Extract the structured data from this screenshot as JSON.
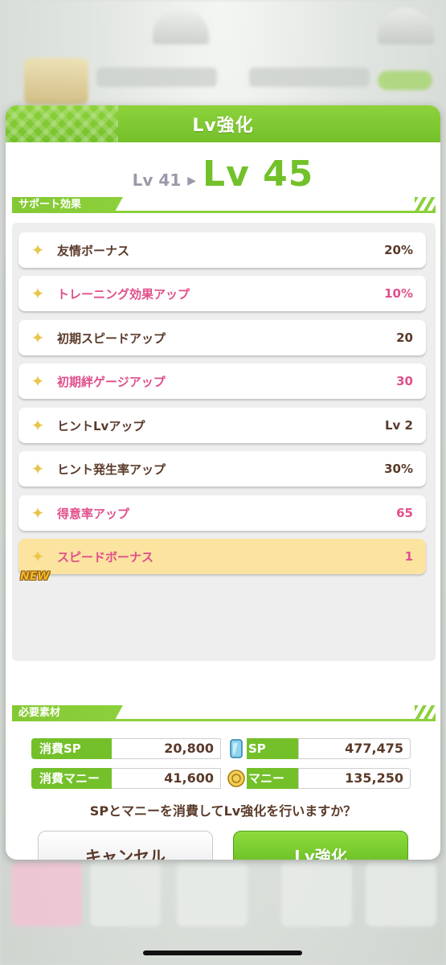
{
  "dialog": {
    "title": "Lv強化",
    "level_from": "Lv 41",
    "level_to": "Lv 45"
  },
  "support_effects": {
    "section_label": "サポート効果",
    "items": [
      {
        "name": "友情ボーナス",
        "value": "20%",
        "highlight": false
      },
      {
        "name": "トレーニング効果アップ",
        "value": "10%",
        "highlight": true
      },
      {
        "name": "初期スピードアップ",
        "value": "20",
        "highlight": false
      },
      {
        "name": "初期絆ゲージアップ",
        "value": "30",
        "highlight": true
      },
      {
        "name": "ヒントLvアップ",
        "value": "Lv 2",
        "highlight": false
      },
      {
        "name": "ヒント発生率アップ",
        "value": "30%",
        "highlight": false
      },
      {
        "name": "得意率アップ",
        "value": "65",
        "highlight": true
      },
      {
        "name": "スピードボーナス",
        "value": "1",
        "highlight": true,
        "new": true
      }
    ],
    "new_tag": "NEW"
  },
  "materials": {
    "section_label": "必要素材",
    "sp_cost_label": "消費SP",
    "sp_cost_value": "20,800",
    "sp_owned_label": "SP",
    "sp_owned_value": "477,475",
    "money_cost_label": "消費マニー",
    "money_cost_value": "41,600",
    "money_owned_label": "マニー",
    "money_owned_value": "135,250"
  },
  "question": "SPとマニーを消費してLv強化を行いますか？",
  "buttons": {
    "cancel": "キャンセル",
    "confirm": "Lv強化"
  },
  "colors": {
    "accent_green": "#74c02a",
    "highlight_pink": "#e0508c",
    "text_brown": "#5a3a2a",
    "new_row": "#fbe3a0"
  }
}
